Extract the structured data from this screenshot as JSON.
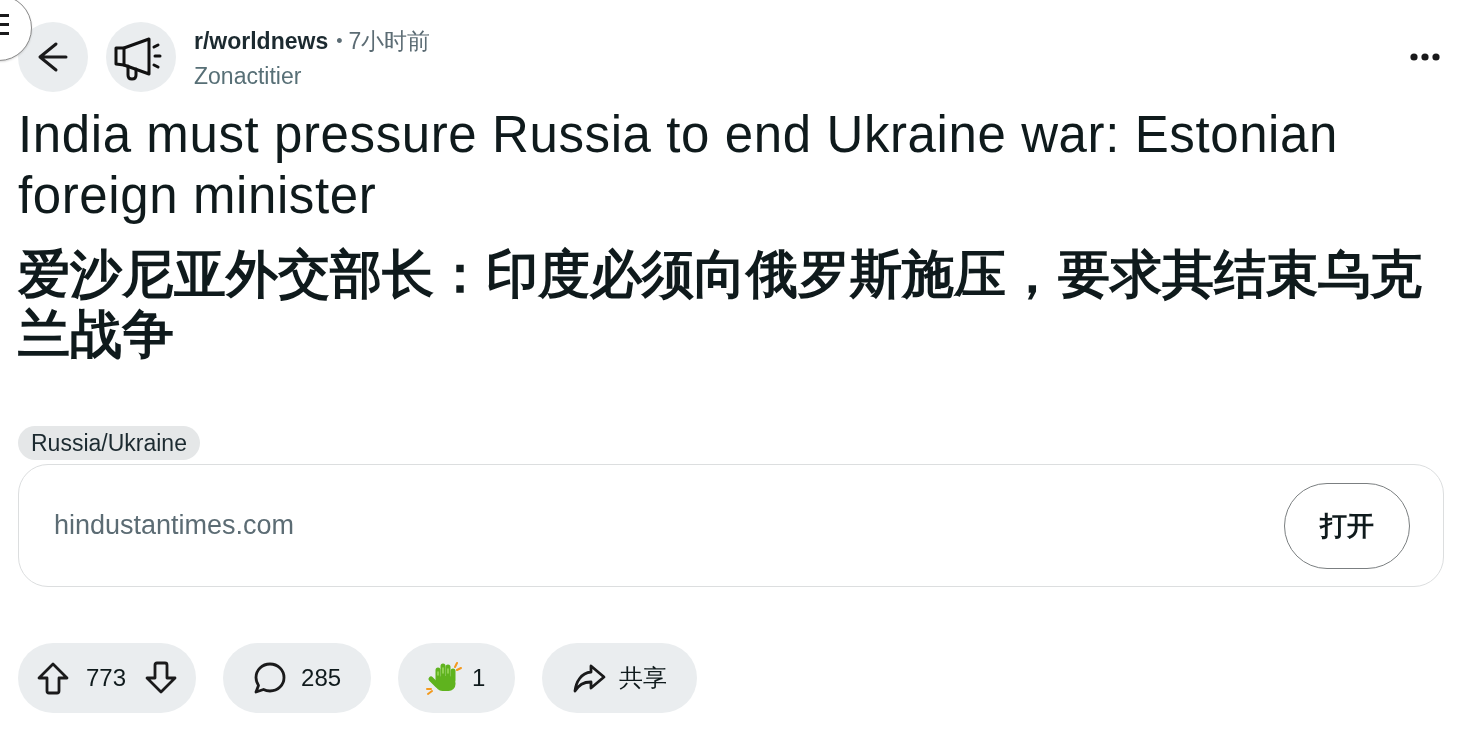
{
  "post": {
    "subreddit": "r/worldnews",
    "separator": "•",
    "time": "7小时前",
    "author": "Zonactitier",
    "title": "India must pressure Russia to end Ukraine war: Estonian foreign minister",
    "title_translation": "爱沙尼亚外交部长：印度必须向俄罗斯施压，要求其结束乌克兰战争",
    "flair": "Russia/Ukraine",
    "link": {
      "domain": "hindustantimes.com",
      "button": "打开"
    }
  },
  "actions": {
    "score": "773",
    "comments": "285",
    "awards": "1",
    "share": "共享"
  }
}
